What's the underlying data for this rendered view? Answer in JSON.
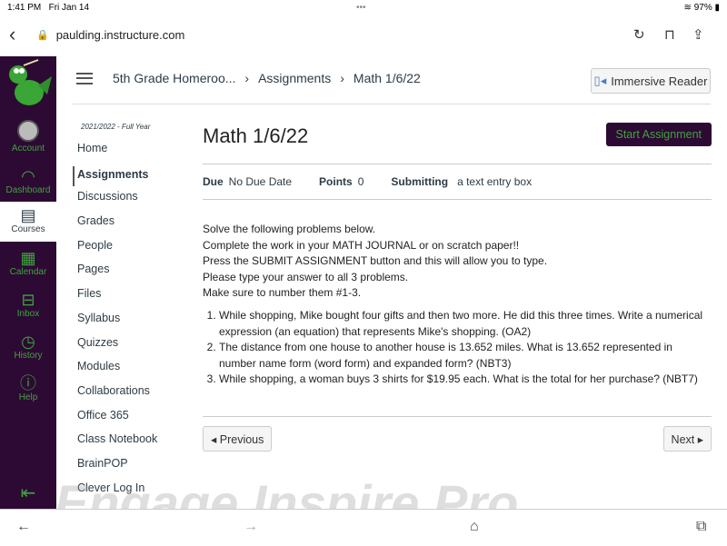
{
  "status": {
    "time": "1:41 PM",
    "date": "Fri Jan 14",
    "battery": "97%"
  },
  "browser": {
    "url": "paulding.instructure.com"
  },
  "global_nav": {
    "items": [
      {
        "label": "Account",
        "icon": "avatar"
      },
      {
        "label": "Dashboard",
        "icon": "speedometer-icon"
      },
      {
        "label": "Courses",
        "icon": "book-icon"
      },
      {
        "label": "Calendar",
        "icon": "calendar-icon"
      },
      {
        "label": "Inbox",
        "icon": "inbox-icon"
      },
      {
        "label": "History",
        "icon": "clock-icon"
      },
      {
        "label": "Help",
        "icon": "question-icon"
      }
    ],
    "accent": "#3fa33f",
    "bg": "#2d0a33"
  },
  "breadcrumb": [
    "5th Grade Homeroo...",
    "Assignments",
    "Math 1/6/22"
  ],
  "immersive_reader": "Immersive Reader",
  "course_nav": {
    "term": "2021/2022 - Full Year",
    "items": [
      "Home",
      "Assignments",
      "Discussions",
      "Grades",
      "People",
      "Pages",
      "Files",
      "Syllabus",
      "Quizzes",
      "Modules",
      "Collaborations",
      "Office 365",
      "Class Notebook",
      "BrainPOP",
      "Clever Log In"
    ]
  },
  "assignment": {
    "title": "Math 1/6/22",
    "start_label": "Start Assignment",
    "due_label": "Due",
    "due": "No Due Date",
    "points_label": "Points",
    "points": "0",
    "submitting_label": "Submitting",
    "submitting": "a text entry box",
    "intro": [
      "Solve the following problems below.",
      "Complete the work in your MATH JOURNAL or on scratch paper!!",
      "Press the SUBMIT ASSIGNMENT button and this will allow you to type.",
      "Please type your answer to all 3 problems.",
      "Make sure to number them #1-3."
    ],
    "problems": [
      "While shopping, Mike bought four gifts and then two more. He did this three times. Write a numerical expression (an equation) that represents Mike's shopping. (OA2)",
      "The distance from one house to another house is 13.652 miles. What is 13.652 represented in number name form (word form) and expanded form? (NBT3)",
      "While shopping, a woman buys 3 shirts for $19.95 each. What is the total for her purchase? (NBT7)"
    ]
  },
  "pager": {
    "previous": "◂ Previous",
    "next": "Next ▸"
  },
  "watermark": "Engage Inspire Pro"
}
